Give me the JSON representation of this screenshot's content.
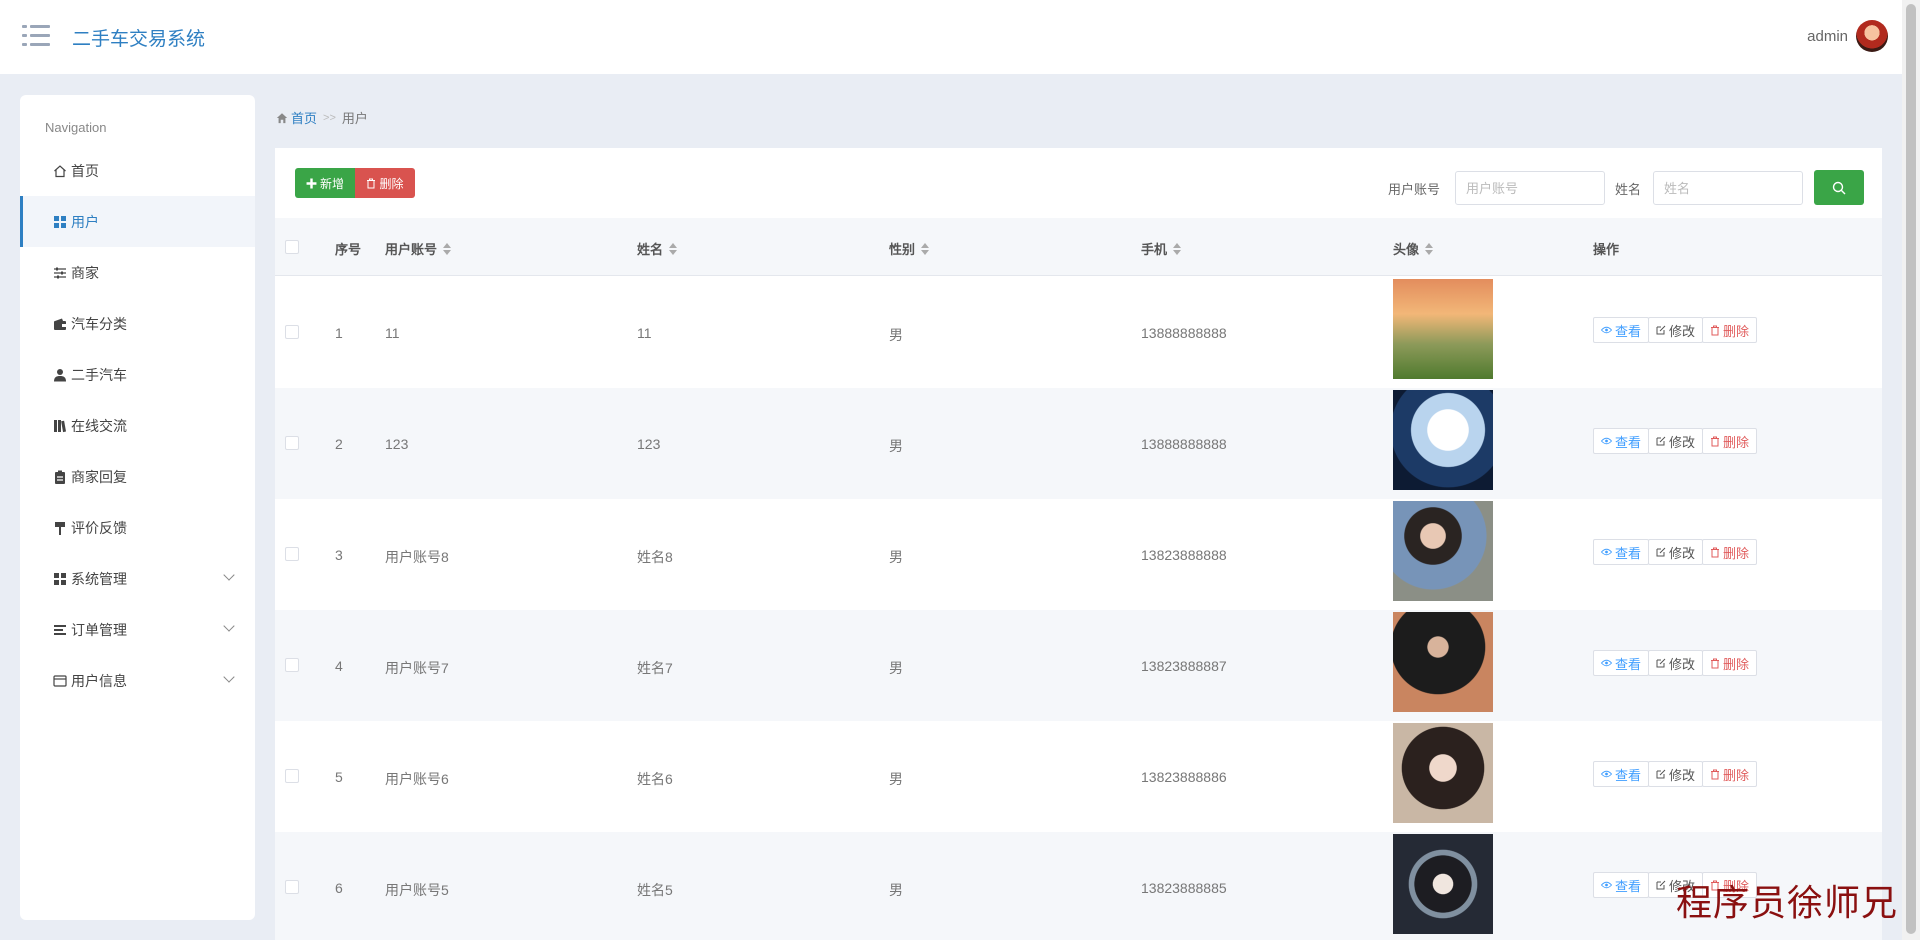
{
  "header": {
    "app_title": "二手车交易系统",
    "username": "admin"
  },
  "sidebar": {
    "caption": "Navigation",
    "items": [
      {
        "label": "首页",
        "icon": "home-icon"
      },
      {
        "label": "用户",
        "icon": "grid-icon",
        "active": true
      },
      {
        "label": "商家",
        "icon": "sliders-icon"
      },
      {
        "label": "汽车分类",
        "icon": "wallet-icon"
      },
      {
        "label": "二手汽车",
        "icon": "user-icon"
      },
      {
        "label": "在线交流",
        "icon": "book-icon"
      },
      {
        "label": "商家回复",
        "icon": "clipboard-icon"
      },
      {
        "label": "评价反馈",
        "icon": "paint-roller-icon"
      },
      {
        "label": "系统管理",
        "icon": "grid-icon",
        "expandable": true
      },
      {
        "label": "订单管理",
        "icon": "list-icon",
        "expandable": true
      },
      {
        "label": "用户信息",
        "icon": "card-icon",
        "expandable": true
      }
    ]
  },
  "breadcrumb": {
    "home": "首页",
    "separator": ">>",
    "current": "用户"
  },
  "toolbar": {
    "add_label": "新增",
    "delete_label": "删除",
    "account_label": "用户账号",
    "account_placeholder": "用户账号",
    "name_label": "姓名",
    "name_placeholder": "姓名"
  },
  "table": {
    "headers": {
      "index": "序号",
      "account": "用户账号",
      "name": "姓名",
      "gender": "性别",
      "phone": "手机",
      "avatar": "头像",
      "actions": "操作"
    },
    "actions": {
      "view": "查看",
      "edit": "修改",
      "delete": "删除"
    },
    "rows": [
      {
        "index": "1",
        "account": "11",
        "name": "11",
        "gender": "男",
        "phone": "13888888888",
        "photo": "anime-sunset-field"
      },
      {
        "index": "2",
        "account": "123",
        "name": "123",
        "gender": "男",
        "phone": "13888888888",
        "photo": "anime-white-hair-girl"
      },
      {
        "index": "3",
        "account": "用户账号8",
        "name": "姓名8",
        "gender": "男",
        "phone": "13823888888",
        "photo": "girl-blue-jacket"
      },
      {
        "index": "4",
        "account": "用户账号7",
        "name": "姓名7",
        "gender": "男",
        "phone": "13823888887",
        "photo": "man-black-coat"
      },
      {
        "index": "5",
        "account": "用户账号6",
        "name": "姓名6",
        "gender": "男",
        "phone": "13823888886",
        "photo": "girl-portrait"
      },
      {
        "index": "6",
        "account": "用户账号5",
        "name": "姓名5",
        "gender": "男",
        "phone": "13823888885",
        "photo": "anime-ninja"
      }
    ]
  },
  "watermark": "程序员徐师兄",
  "colors": {
    "primary": "#2e7fc2",
    "success": "#3aa547",
    "danger": "#d9534f",
    "view": "#409eff"
  }
}
